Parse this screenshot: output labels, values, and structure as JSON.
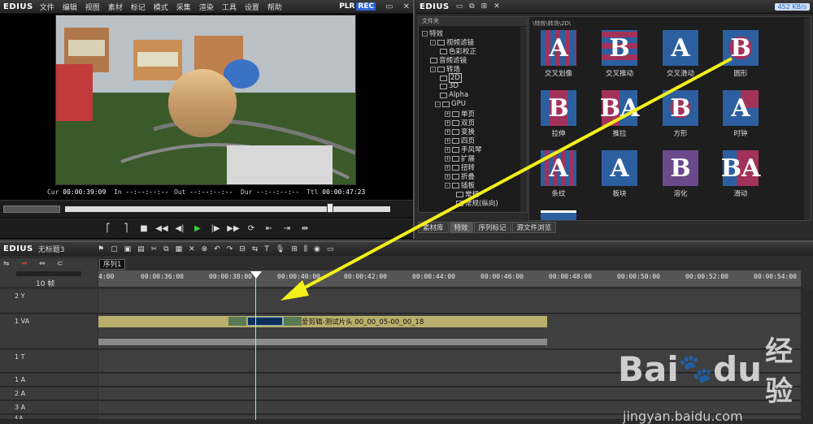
{
  "player": {
    "brand": "EDIUS",
    "menu": [
      "文件",
      "编辑",
      "视图",
      "素材",
      "标记",
      "模式",
      "采集",
      "渲染",
      "工具",
      "设置",
      "帮助"
    ],
    "plr": "PLR",
    "rec": "REC",
    "timecodes": {
      "cur_label": "Cur",
      "cur": "00:00:39:09",
      "in_label": "In",
      "in": "--:--:--:--",
      "out_label": "Out",
      "out": "--:--:--:--",
      "dur_label": "Dur",
      "dur": "--:--:--:--",
      "ttl_label": "Ttl",
      "ttl": "00:00:47:23"
    }
  },
  "effects": {
    "brand": "EDIUS",
    "speed": "452 KB/s",
    "tree_header": "文件夹",
    "path": "\\特效\\转场\\2D\\",
    "tree": [
      "特效",
      "视频滤镜",
      "色彩校正",
      "音频滤镜",
      "转场",
      "2D",
      "3D",
      "Alpha",
      "GPU",
      "单页",
      "双页",
      "变换",
      "四页",
      "手风琴",
      "扩展",
      "扭转",
      "折叠",
      "插板",
      "常规",
      "常规(纵向)"
    ],
    "items": [
      "交叉划像",
      "交叉推动",
      "交叉滑动",
      "圆形",
      "拉伸",
      "推拉",
      "方形",
      "时钟",
      "条纹",
      "板块",
      "溶化",
      "滑动"
    ],
    "tabs": [
      "素材库",
      "特效",
      "序列标记",
      "源文件浏览"
    ]
  },
  "timeline": {
    "brand": "EDIUS",
    "project": "无标题3",
    "sequence_tab": "序列1",
    "zoom": "10 帧",
    "ruler": [
      "4:00",
      "00:00:36:00",
      "00:00:38:00",
      "00:00:40:00",
      "00:00:42:00",
      "00:00:44:00",
      "00:00:46:00",
      "00:00:48:00",
      "00:00:50:00",
      "00:00:52:00",
      "00:00:54:00"
    ],
    "tracks": [
      "2 Y",
      "1 VA",
      "1 T",
      "1 A",
      "2 A",
      "3 A",
      "4 A"
    ],
    "clip_label": "爱剪辑-测试片头 00_00_05-00_00_18"
  },
  "watermark": {
    "brand": "Bai",
    "brand2": "du",
    "cn": "经验",
    "url": "jingyan.baidu.com"
  }
}
